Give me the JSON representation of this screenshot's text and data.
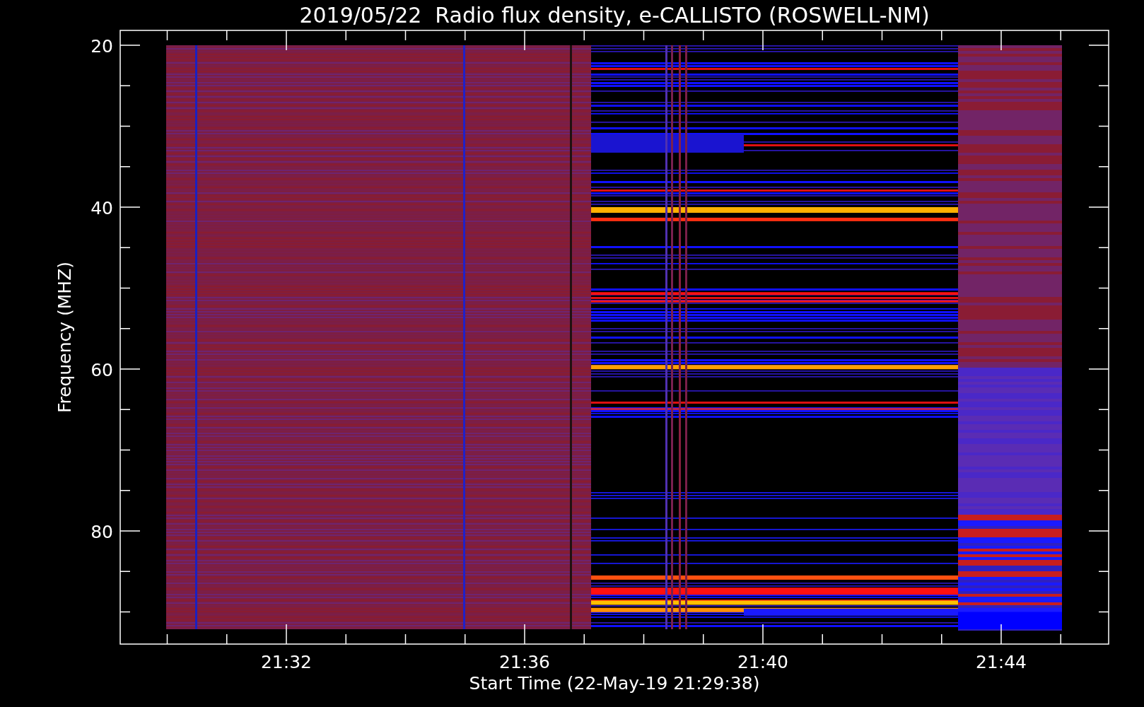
{
  "title": "2019/05/22  Radio flux density, e-CALLISTO (ROSWELL-NM)",
  "y_axis": {
    "label": "Frequency (MHZ)",
    "ticks": [
      "20",
      "40",
      "60",
      "80"
    ]
  },
  "x_axis": {
    "label": "Start Time (22-May-19 21:29:38)",
    "ticks": [
      "21:32",
      "21:36",
      "21:40",
      "21:44"
    ]
  }
}
